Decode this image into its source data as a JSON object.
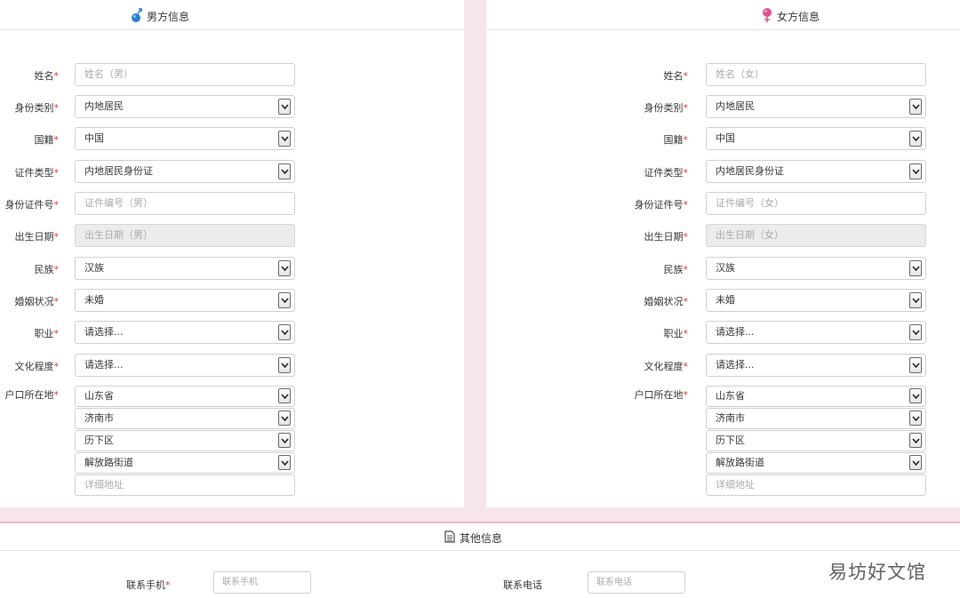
{
  "male": {
    "title": "男方信息",
    "fields": [
      {
        "label": "姓名",
        "type": "text",
        "value": "",
        "placeholder": "姓名（男）"
      },
      {
        "label": "身份类别",
        "type": "select",
        "value": "内地居民"
      },
      {
        "label": "国籍",
        "type": "select",
        "value": "中国"
      },
      {
        "label": "证件类型",
        "type": "select",
        "value": "内地居民身份证"
      },
      {
        "label": "身份证件号",
        "type": "text",
        "value": "",
        "placeholder": "证件编号（男）"
      },
      {
        "label": "出生日期",
        "type": "disabled",
        "value": "",
        "placeholder": "出生日期（男）"
      },
      {
        "label": "民族",
        "type": "select",
        "value": "汉族"
      },
      {
        "label": "婚姻状况",
        "type": "select",
        "value": "未婚"
      },
      {
        "label": "职业",
        "type": "select",
        "value": "请选择..."
      },
      {
        "label": "文化程度",
        "type": "select",
        "value": "请选择..."
      }
    ],
    "address": {
      "label": "户口所在地",
      "province": "山东省",
      "city": "济南市",
      "district": "历下区",
      "street": "解放路街道",
      "detail_placeholder": "详细地址"
    }
  },
  "female": {
    "title": "女方信息",
    "fields": [
      {
        "label": "姓名",
        "type": "text",
        "value": "",
        "placeholder": "姓名（女）"
      },
      {
        "label": "身份类别",
        "type": "select",
        "value": "内地居民"
      },
      {
        "label": "国籍",
        "type": "select",
        "value": "中国"
      },
      {
        "label": "证件类型",
        "type": "select",
        "value": "内地居民身份证"
      },
      {
        "label": "身份证件号",
        "type": "text",
        "value": "",
        "placeholder": "证件编号（女）"
      },
      {
        "label": "出生日期",
        "type": "disabled",
        "value": "",
        "placeholder": "出生日期（女）"
      },
      {
        "label": "民族",
        "type": "select",
        "value": "汉族"
      },
      {
        "label": "婚姻状况",
        "type": "select",
        "value": "未婚"
      },
      {
        "label": "职业",
        "type": "select",
        "value": "请选择..."
      },
      {
        "label": "文化程度",
        "type": "select",
        "value": "请选择..."
      }
    ],
    "address": {
      "label": "户口所在地",
      "province": "山东省",
      "city": "济南市",
      "district": "历下区",
      "street": "解放路街道",
      "detail_placeholder": "详细地址"
    }
  },
  "other": {
    "title": "其他信息",
    "mobile_label": "联系手机",
    "mobile_placeholder": "联系手机",
    "phone_label": "联系电话",
    "phone_placeholder": "联系电话"
  },
  "required_mark": "*",
  "watermark": "易坊好文馆",
  "colors": {
    "required": "#e0303a",
    "male_icon": "#2a7fd0",
    "female_icon": "#e0508c",
    "page_bg": "#f6e6ea"
  }
}
